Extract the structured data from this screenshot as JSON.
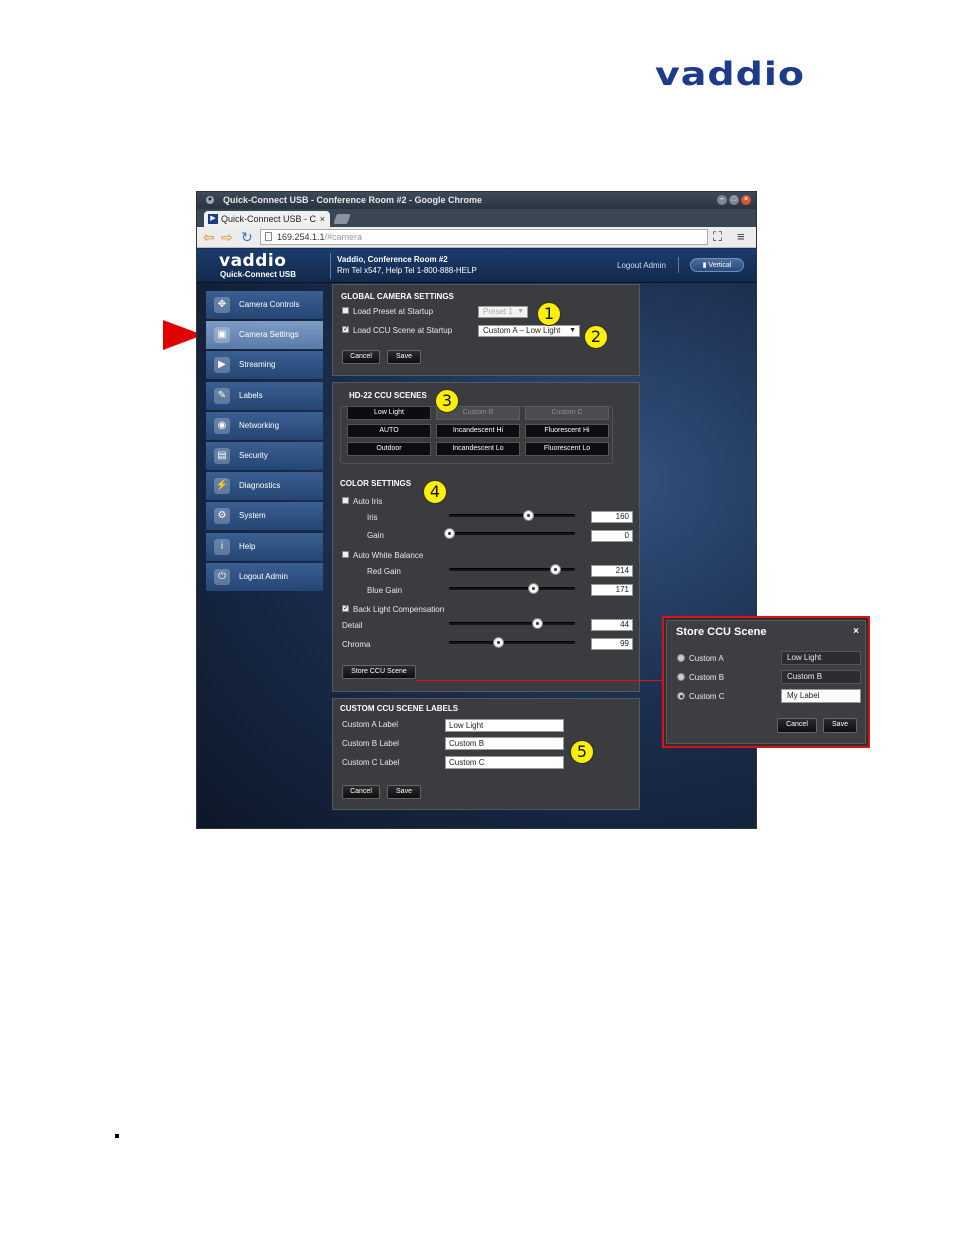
{
  "page_logo": "vaddio",
  "browser": {
    "window_title": "Quick-Connect USB - Conference Room #2 - Google Chrome",
    "tab_label": "Quick-Connect USB - C",
    "url_host": "169.254.1.1",
    "url_path": "/#camera"
  },
  "header": {
    "logo": "vaddio",
    "subtitle": "Quick-Connect USB",
    "room_name": "Vaddio, Conference Room #2",
    "room_info": "Rm Tel x547, Help Tel 1-800-888-HELP",
    "logout": "Logout Admin",
    "vertical": "Vertical"
  },
  "sidebar": {
    "items": [
      {
        "label": "Camera Controls",
        "icon": "camera-controls-icon"
      },
      {
        "label": "Camera Settings",
        "icon": "camera-settings-icon"
      },
      {
        "label": "Streaming",
        "icon": "streaming-icon"
      },
      {
        "label": "Labels",
        "icon": "labels-icon"
      },
      {
        "label": "Networking",
        "icon": "networking-icon"
      },
      {
        "label": "Security",
        "icon": "security-icon"
      },
      {
        "label": "Diagnostics",
        "icon": "diagnostics-icon"
      },
      {
        "label": "System",
        "icon": "system-icon"
      },
      {
        "label": "Help",
        "icon": "help-icon"
      },
      {
        "label": "Logout Admin",
        "icon": "logout-icon"
      }
    ],
    "active_index": 1
  },
  "global": {
    "title": "GLOBAL CAMERA SETTINGS",
    "load_preset_label": "Load Preset at Startup",
    "load_preset_checked": false,
    "preset_value": "Preset 1",
    "load_ccu_label": "Load CCU Scene at Startup",
    "load_ccu_checked": true,
    "ccu_value": "Custom A – Low Light",
    "cancel": "Cancel",
    "save": "Save"
  },
  "scenes": {
    "title": "HD-22 CCU SCENES",
    "buttons": [
      [
        "Low Light",
        "Custom B",
        "Custom C"
      ],
      [
        "AUTO",
        "Incandescent Hi",
        "Fluorescent Hi"
      ],
      [
        "Outdoor",
        "Incandescent Lo",
        "Fluorescent Lo"
      ]
    ]
  },
  "color": {
    "title": "COLOR SETTINGS",
    "auto_iris": "Auto Iris",
    "iris_label": "Iris",
    "iris": 160,
    "gain_label": "Gain",
    "gain": 0,
    "awb": "Auto White Balance",
    "red_label": "Red Gain",
    "red": 214,
    "blue_label": "Blue Gain",
    "blue": 171,
    "blc": "Back Light Compensation",
    "detail_label": "Detail",
    "detail": 44,
    "chroma_label": "Chroma",
    "chroma": 99,
    "store": "Store CCU Scene"
  },
  "labels_panel": {
    "title": "CUSTOM CCU SCENE LABELS",
    "a_label": "Custom A Label",
    "a_value": "Low Light",
    "b_label": "Custom B Label",
    "b_value": "Custom B",
    "c_label": "Custom C Label",
    "c_value": "Custom C",
    "cancel": "Cancel",
    "save": "Save"
  },
  "popup": {
    "title": "Store CCU Scene",
    "close": "×",
    "a": "Custom A",
    "a_value": "Low Light",
    "b": "Custom B",
    "b_value": "Custom B",
    "c": "Custom C",
    "c_value": "My Label",
    "cancel": "Cancel",
    "save": "Save"
  },
  "callouts": [
    "1",
    "2",
    "3",
    "4",
    "5"
  ],
  "colors": {
    "accent_callout": "#ffef00",
    "arrow": "#e00000",
    "popup_border": "#dd1111"
  }
}
